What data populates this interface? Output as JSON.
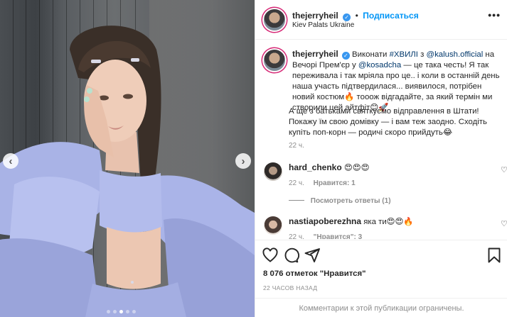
{
  "header": {
    "username": "thejerryheil",
    "follow_label": "Подписаться",
    "separator": "•",
    "location": "Kiev Palats Ukraine",
    "more_label": "•••"
  },
  "caption": {
    "username": "thejerryheil",
    "segments": [
      {
        "text": "Виконати ",
        "link": false
      },
      {
        "text": "#ХВИЛІ",
        "link": true
      },
      {
        "text": " з ",
        "link": false
      },
      {
        "text": "@kalush.official",
        "link": true
      },
      {
        "text": " на Вечорі Прем'єр у ",
        "link": false
      },
      {
        "text": "@kosadcha",
        "link": true
      },
      {
        "text": " — це така честь! Я так переживала і так мріяла про це.. і коли в останній день наша участь підтвердилася... виявилося, потрібен новий костюм🔥 тооож вiдгадайте, за який термін ми створили цей айтфіт😊🚀",
        "link": false
      }
    ],
    "paragraph2": "А ще з батьками святкуємо відправлення в Штати! Покажу їм свою домівку — і вам теж заодно. Сходіть купіть поп-корн — родичі скоро прийдуть😂",
    "time": "22 ч."
  },
  "comments": [
    {
      "username": "hard_chenko",
      "text": "😍😍😍",
      "time": "22 ч.",
      "likes_label": "Нравится: 1",
      "view_replies": "Посмотреть ответы (1)"
    },
    {
      "username": "nastiapoberezhna",
      "text": "яка ти😍😍🔥",
      "time": "22 ч.",
      "likes_label": "\"Нравится\": 3"
    }
  ],
  "footer": {
    "likes": "8 076 отметок \"Нравится\"",
    "time_ago": "22 ЧАСОВ НАЗАД",
    "comments_limited": "Комментарии к этой публикации ограничены."
  },
  "icons": {
    "verified": "verified-badge-icon",
    "heart": "heart-icon",
    "comment": "comment-icon",
    "share": "share-icon",
    "save": "bookmark-icon",
    "prev": "chevron-left-icon",
    "next": "chevron-right-icon"
  },
  "colors": {
    "accent_link": "#0095f6",
    "mention": "#00376b",
    "muted": "#8e8e8e",
    "dress": "#a9b3e6"
  },
  "carousel": {
    "count": 5,
    "active_index": 2
  }
}
